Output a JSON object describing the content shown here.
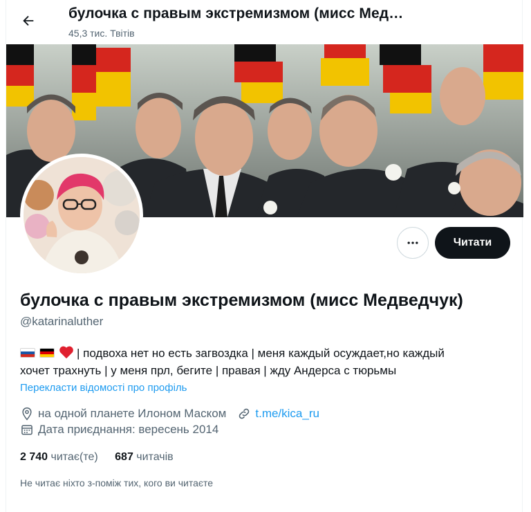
{
  "header": {
    "title": "булочка с правым экстремизмом (мисс Мед…",
    "tweets_count": "45,3 тис. Твітів"
  },
  "actions": {
    "follow_label": "Читати",
    "more_icon": "more-horizontal-icon"
  },
  "profile": {
    "name": "булочка с правым экстремизмом (мисс Медведчук)",
    "handle": "@katarinaluther",
    "bio_line1": "| подвоха нет но есть загвоздка | меня каждый осуждает,но каждый",
    "bio_line2": "хочет трахнуть | у меня прл, бегите | правая | жду Андерса с тюрьмы",
    "bio_emojis": [
      "flag-russia",
      "flag-germany",
      "red-heart"
    ],
    "translate_link": "Перекласти відомості про профіль",
    "location": "на одной планете Илоном Маском",
    "website": "t.me/kica_ru",
    "joined": "Дата приєднання: вересень 2014"
  },
  "stats": {
    "following_count": "2 740",
    "following_label": "читає(те)",
    "followers_count": "687",
    "followers_label": "читачів"
  },
  "followers_you_know": "Не читає ніхто з-поміж тих, кого ви читаєте",
  "colors": {
    "accent": "#1d9bf0",
    "text_primary": "#0f1419",
    "text_secondary": "#536471",
    "button_dark": "#0f1419"
  }
}
